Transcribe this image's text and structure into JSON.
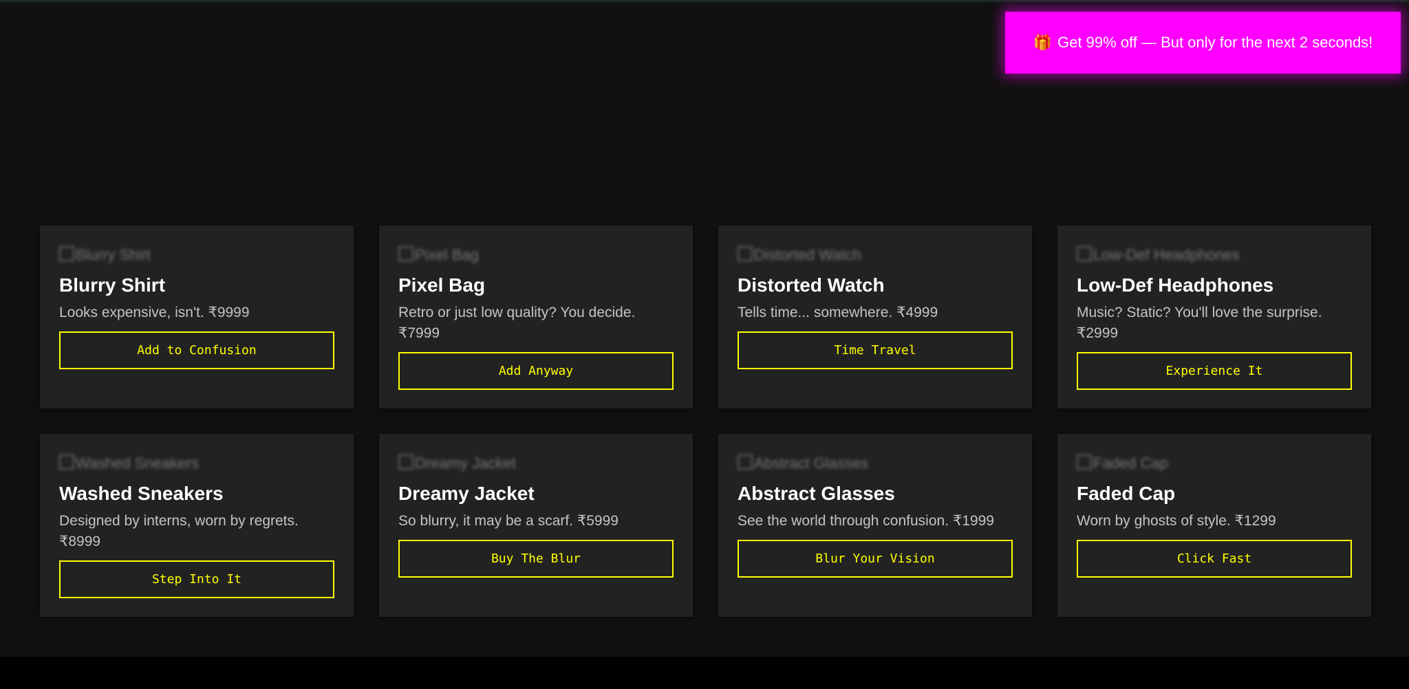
{
  "promo": {
    "icon": "gift-icon",
    "icon_glyph": "🎁",
    "text": "Get 99% off — But only for the next 2 seconds!",
    "color": "#ff00ff"
  },
  "accent_color": "#ffff00",
  "products": [
    {
      "image_alt": "Blurry Shirt",
      "name": "Blurry Shirt",
      "desc": "Looks expensive, isn't. ₹9999",
      "button": "Add to Confusion"
    },
    {
      "image_alt": "Pixel Bag",
      "name": "Pixel Bag",
      "desc": "Retro or just low quality? You decide. ₹7999",
      "button": "Add Anyway"
    },
    {
      "image_alt": "Distorted Watch",
      "name": "Distorted Watch",
      "desc": "Tells time... somewhere. ₹4999",
      "button": "Time Travel"
    },
    {
      "image_alt": "Low-Def Headphones",
      "name": "Low-Def Headphones",
      "desc": "Music? Static? You'll love the surprise. ₹2999",
      "button": "Experience It"
    },
    {
      "image_alt": "Washed Sneakers",
      "name": "Washed Sneakers",
      "desc": "Designed by interns, worn by regrets. ₹8999",
      "button": "Step Into It"
    },
    {
      "image_alt": "Dreamy Jacket",
      "name": "Dreamy Jacket",
      "desc": "So blurry, it may be a scarf. ₹5999",
      "button": "Buy The Blur"
    },
    {
      "image_alt": "Abstract Glasses",
      "name": "Abstract Glasses",
      "desc": "See the world through confusion. ₹1999",
      "button": "Blur Your Vision"
    },
    {
      "image_alt": "Faded Cap",
      "name": "Faded Cap",
      "desc": "Worn by ghosts of style. ₹1299",
      "button": "Click Fast"
    }
  ]
}
